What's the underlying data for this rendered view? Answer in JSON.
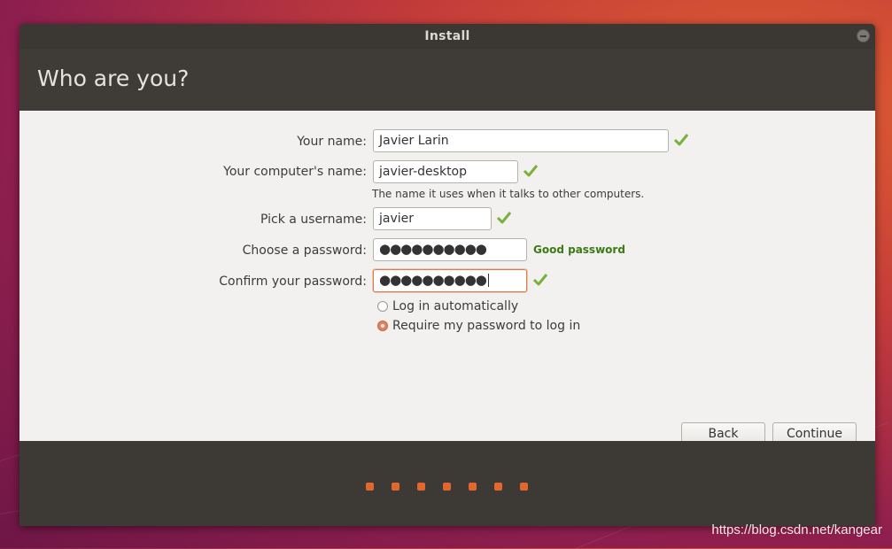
{
  "window": {
    "title": "Install"
  },
  "header": {
    "title": "Who are you?"
  },
  "form": {
    "name_label": "Your name:",
    "name_value": "Javier Larin",
    "computer_label": "Your computer's name:",
    "computer_value": "javier-desktop",
    "computer_hint": "The name it uses when it talks to other computers.",
    "username_label": "Pick a username:",
    "username_value": "javier",
    "password_label": "Choose a password:",
    "password_value": "●●●●●●●●●●",
    "password_strength": "Good password",
    "confirm_label": "Confirm your password:",
    "confirm_value": "●●●●●●●●●●",
    "login_options": [
      {
        "label": "Log in automatically",
        "checked": false
      },
      {
        "label": "Require my password to log in",
        "checked": true
      }
    ]
  },
  "buttons": {
    "back": "Back",
    "continue": "Continue"
  },
  "progress": {
    "total_steps": 7
  },
  "colors": {
    "accent": "#e2672f",
    "valid_check": "#7bb03a",
    "strength_good": "#3b7a14"
  },
  "watermark": "https://blog.csdn.net/kangear"
}
